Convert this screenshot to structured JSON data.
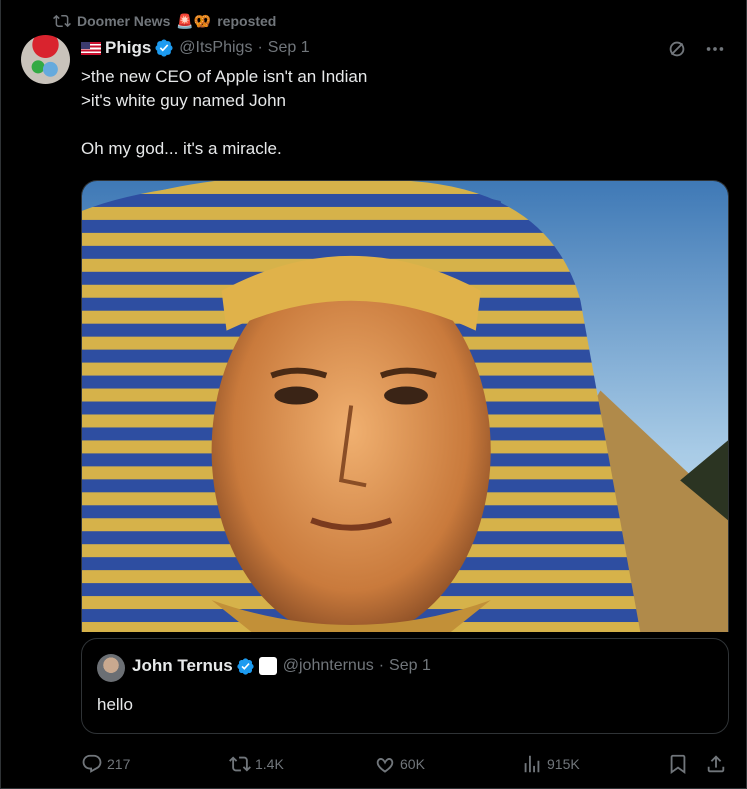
{
  "repost": {
    "user": "Doomer News",
    "emoji": "🚨🥨",
    "label": "reposted"
  },
  "tweet": {
    "name": "Phigs",
    "handle": "@ItsPhigs",
    "separator": "·",
    "time": "Sep 1",
    "lines": [
      ">the new CEO of Apple isn't an Indian",
      ">it's white guy named John",
      "",
      "Oh my god... it's a miracle."
    ]
  },
  "quote": {
    "name": "John Ternus",
    "affiliation_glyph": "",
    "handle": "@johnternus",
    "separator": "·",
    "time": "Sep 1",
    "text": "hello"
  },
  "actions": {
    "replies": "217",
    "reposts": "1.4K",
    "likes": "60K",
    "views": "915K"
  },
  "colors": {
    "background": "#000000",
    "text": "#e7e9ea",
    "muted": "#71767b",
    "verified": "#1d9bf0",
    "border": "#2f3336"
  },
  "icons": [
    "repost-icon",
    "verified-icon",
    "grok-icon",
    "more-icon",
    "reply-icon",
    "like-icon",
    "views-icon",
    "bookmark-icon",
    "share-icon"
  ]
}
